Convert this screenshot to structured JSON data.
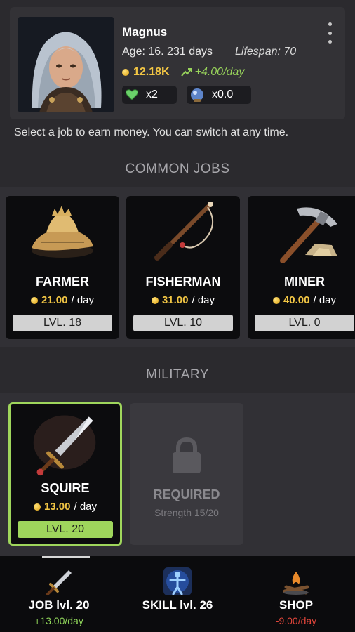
{
  "profile": {
    "name": "Magnus",
    "age": "Age: 16. 231 days",
    "lifespan": "Lifespan: 70",
    "money": "12.18K",
    "income": "+4.00/day",
    "heart_multiplier": "x2",
    "orb_multiplier": "x0.0",
    "portrait": "character-portrait"
  },
  "info_text": "Select a job to earn money. You can switch at any time.",
  "sections": {
    "common": "COMMON JOBS",
    "military": "MILITARY"
  },
  "common_jobs": [
    {
      "name": "FARMER",
      "pay": "21.00",
      "per": "/ day",
      "level": "LVL. 18",
      "icon": "farmer-hat-icon"
    },
    {
      "name": "FISHERMAN",
      "pay": "31.00",
      "per": "/ day",
      "level": "LVL. 10",
      "icon": "fishing-rod-icon"
    },
    {
      "name": "MINER",
      "pay": "40.00",
      "per": "/ day",
      "level": "LVL. 0",
      "icon": "pickaxe-icon"
    }
  ],
  "military_jobs": [
    {
      "name": "SQUIRE",
      "pay": "13.00",
      "per": "/ day",
      "level": "LVL. 20",
      "icon": "sword-icon",
      "selected": true
    }
  ],
  "locked_job": {
    "label": "REQUIRED",
    "requirement": "Strength 15/20",
    "icon": "lock-icon"
  },
  "nav": [
    {
      "label": "JOB lvl. 20",
      "sub": "+13.00/day",
      "sub_color": "#8fd45a",
      "icon": "sword-icon"
    },
    {
      "label": "SKILL lvl. 26",
      "sub": "",
      "icon": "skill-figure-icon"
    },
    {
      "label": "SHOP",
      "sub": "-9.00/day",
      "sub_color": "#e0453a",
      "icon": "shop-campfire-icon"
    }
  ],
  "colors": {
    "background": "#2b2a2e",
    "gold": "#f1c544",
    "green": "#98d35b",
    "selected_border": "#9fd65c",
    "red": "#e0453a"
  }
}
